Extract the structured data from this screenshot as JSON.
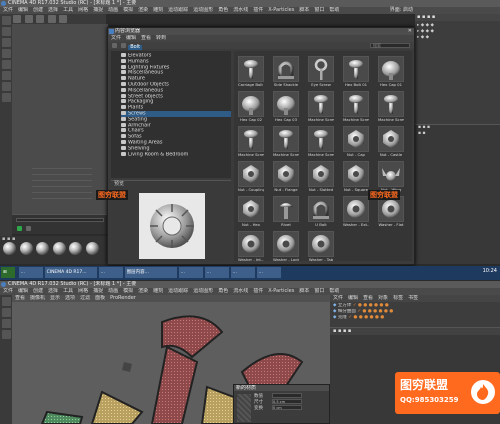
{
  "top_window": {
    "title": "CINEMA 4D R17.032 Studio (RC) - [未标题 1 *] - 主要",
    "menu": [
      "文件",
      "编辑",
      "创建",
      "选择",
      "工具",
      "网格",
      "捕捉",
      "动画",
      "模拟",
      "渲染",
      "雕刻",
      "运动跟踪",
      "运动图形",
      "角色",
      "流水线",
      "插件",
      "X-Particles",
      "脚本",
      "窗口",
      "帮助"
    ],
    "layout_label": "界面:",
    "layout_value": "启动"
  },
  "browser": {
    "title": "内容浏览器",
    "tabs": [
      "文件",
      "编辑",
      "查看",
      "转到"
    ],
    "search_placeholder": "搜索",
    "path": "Bolt",
    "tree_items": [
      {
        "label": "Elevators",
        "sel": false
      },
      {
        "label": "Humans",
        "sel": false
      },
      {
        "label": "Lighting Fixtures",
        "sel": false
      },
      {
        "label": "Miscellaneous",
        "sel": false
      },
      {
        "label": "Nature",
        "sel": false
      },
      {
        "label": "Outdoor Objects",
        "sel": false
      },
      {
        "label": "Miscellaneous",
        "sel": false
      },
      {
        "label": "Street objects",
        "sel": false
      },
      {
        "label": "Packaging",
        "sel": false
      },
      {
        "label": "Plants",
        "sel": false
      },
      {
        "label": "Screws",
        "sel": true
      },
      {
        "label": "Seating",
        "sel": false
      },
      {
        "label": "Armchair",
        "sel": false
      },
      {
        "label": "Chairs",
        "sel": false
      },
      {
        "label": "Sofas",
        "sel": false
      },
      {
        "label": "Waiting Areas",
        "sel": false
      },
      {
        "label": "Shelving",
        "sel": false
      },
      {
        "label": "Living Room & Bedroom",
        "sel": false
      }
    ],
    "preview_tab": "预览",
    "grid_items": [
      [
        "Carriage Bolt 01",
        "Side Shackle",
        "Eye Screw",
        "Hex Bolt 01",
        "Hex Cap 01"
      ],
      [
        "Hex Cap 02",
        "Hex Cap 03",
        "Machine Screw...",
        "Machine Screw...",
        "Machine Screw..."
      ],
      [
        "Machine Screw...",
        "Machine Screw...",
        "Machine Screw...",
        "Nut - Cap",
        "Nut - Castle"
      ],
      [
        "Nut - Coupling",
        "Nut - Flange",
        "Nut - Slotted",
        "Nut - Square",
        "Nut - Wing"
      ],
      [
        "Nut - Hex",
        "Rivet",
        "U Bolt",
        "Washer - Ext...",
        "Washer - Flat"
      ],
      [
        "Washer - Int...",
        "Washer - Lock",
        "Washer - Tab",
        "",
        ""
      ]
    ],
    "preview_path": "预置"
  },
  "bottom_window": {
    "title": "CINEMA 4D R17.032 Studio (RC) - [未标题 1 *] - 主要",
    "menu": [
      "文件",
      "编辑",
      "创建",
      "选择",
      "工具",
      "网格",
      "捕捉",
      "动画",
      "模拟",
      "渲染",
      "雕刻",
      "运动跟踪",
      "运动图形",
      "角色",
      "流水线",
      "插件",
      "X-Particles",
      "脚本",
      "窗口",
      "帮助"
    ],
    "view_menu": [
      "查看",
      "摄像机",
      "显示",
      "选项",
      "过滤",
      "面板",
      "ProRender"
    ],
    "dialog_title": "新的材质",
    "dialog_rows": [
      {
        "label": "数值",
        "value": ""
      },
      {
        "label": "尺寸",
        "value": "0.5 cm"
      },
      {
        "label": "变换",
        "value": "0 cm"
      }
    ],
    "objects_menu": [
      "文件",
      "编辑",
      "查看",
      "对象",
      "标签",
      "书签"
    ],
    "object_rows": [
      "立方体",
      "细分曲面",
      "克隆"
    ]
  },
  "taskbar": {
    "buttons": [
      "...",
      "CINEMA 4D R17...",
      "...",
      "图层内容...",
      "...",
      "...",
      "...",
      "..."
    ],
    "time": "10:24"
  },
  "watermark": {
    "title": "图穷联盟",
    "qq": "QQ:985303259",
    "mid_logo": "图穷联盟"
  },
  "colors": {
    "accent": "#ff6a1f",
    "selection": "#2f5c86",
    "taskbar": "#1e3a5f"
  }
}
